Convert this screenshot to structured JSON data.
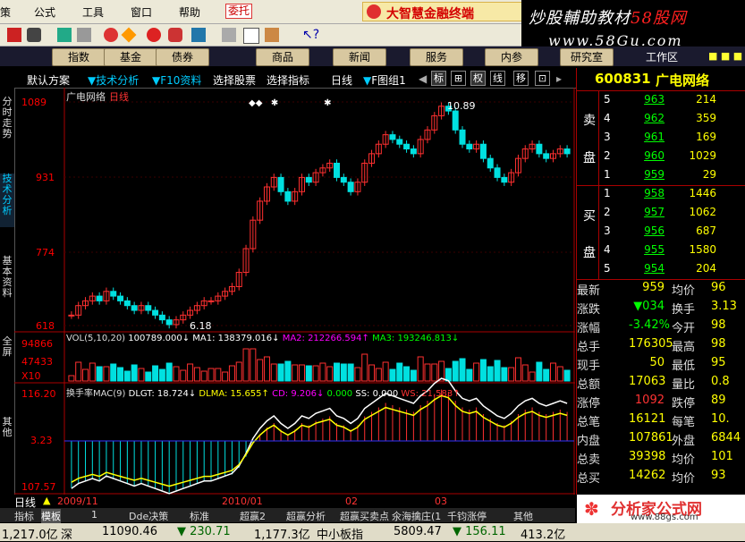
{
  "menu": {
    "items": [
      "策",
      "公式",
      "工具",
      "窗口",
      "帮助"
    ],
    "entrust": "委托"
  },
  "brand": {
    "title": "大智慧金融终端"
  },
  "watermark": {
    "line1_a": "炒股輔助教材",
    "line1_b": "58股网",
    "line2": "www.58Gu.com"
  },
  "nav": {
    "buttons": [
      "指数",
      "基金",
      "债券",
      "商品",
      "新闻",
      "服务",
      "内参",
      "研究室"
    ],
    "workarea": "工作区",
    "close": "■ ■ ■"
  },
  "subbar": {
    "items": [
      "默认方案",
      "技术分析",
      "F10资料",
      "选择股票",
      "选择指标",
      "日线",
      "F图组1"
    ],
    "boxes": [
      "标",
      "⊞",
      "权",
      "线",
      "移",
      "⊡"
    ]
  },
  "sidetabs": [
    "分时走势",
    "技术分析",
    "基本资料",
    "全屏",
    "其他"
  ],
  "chart": {
    "title": "广电网络",
    "period": "日线",
    "price_ticks": [
      "1089",
      "931",
      "774",
      "618"
    ],
    "high_label": "10.89",
    "low_label": "6.18",
    "vol_legend": {
      "name": "VOL(5,10,20)",
      "v": "100789.000↓",
      "ma1": "MA1: 138379.016↓",
      "ma2": "MA2: 212266.594↑",
      "ma3": "MA3: 193246.813↓"
    },
    "vol_ticks": [
      "94866",
      "47433",
      "X10"
    ],
    "macd_legend": {
      "name": "换手率MAC(9)",
      "dlgt": "DLGT: 18.724↓",
      "dlma": "DLMA: 15.655↑",
      "cd": "CD: 9.206↓",
      "zero": "0.000",
      "ss": "SS: 0.000",
      "ws": "WS: 21.583↑"
    },
    "macd_ticks": [
      "116.20",
      "3.23",
      "107.57"
    ],
    "dates": [
      "日线",
      "2009/11",
      "2010/01",
      "02",
      "03"
    ]
  },
  "chart_data": {
    "type": "candlestick",
    "title": "广电网络",
    "period": "日线",
    "ylim": [
      6.18,
      10.89
    ],
    "price_ticks": [
      10.89,
      9.31,
      7.74,
      6.18
    ],
    "high": 10.89,
    "low": 6.18,
    "dates": [
      "2009/11",
      "2010/01",
      "02",
      "03"
    ]
  },
  "quote": {
    "code": "600831",
    "name": "广电网络",
    "sell_label": [
      "卖",
      "盘"
    ],
    "buy_label": [
      "买",
      "盘"
    ],
    "asks": [
      {
        "i": "5",
        "p": "963",
        "v": "214"
      },
      {
        "i": "4",
        "p": "962",
        "v": "359"
      },
      {
        "i": "3",
        "p": "961",
        "v": "169"
      },
      {
        "i": "2",
        "p": "960",
        "v": "1029"
      },
      {
        "i": "1",
        "p": "959",
        "v": "29"
      }
    ],
    "bids": [
      {
        "i": "1",
        "p": "958",
        "v": "1446"
      },
      {
        "i": "2",
        "p": "957",
        "v": "1062"
      },
      {
        "i": "3",
        "p": "956",
        "v": "687"
      },
      {
        "i": "4",
        "p": "955",
        "v": "1580"
      },
      {
        "i": "5",
        "p": "954",
        "v": "204"
      }
    ],
    "stats": [
      {
        "l": "最新",
        "v": "959",
        "l2": "均价",
        "v2": "96"
      },
      {
        "l": "涨跌",
        "v": "▼034",
        "l2": "换手",
        "v2": "3.13"
      },
      {
        "l": "涨幅",
        "v": "-3.42%",
        "l2": "今开",
        "v2": "98"
      },
      {
        "l": "总手",
        "v": "176305",
        "l2": "最高",
        "v2": "98"
      },
      {
        "l": "现手",
        "v": "50",
        "l2": "最低",
        "v2": "95"
      },
      {
        "l": "总额",
        "v": "17063",
        "l2": "量比",
        "v2": "0.8"
      },
      {
        "l": "涨停",
        "v": "1092",
        "l2": "跌停",
        "v2": "89"
      },
      {
        "l": "总笔",
        "v": "16121",
        "l2": "每笔",
        "v2": "10."
      },
      {
        "l": "内盘",
        "v": "107861",
        "l2": "外盘",
        "v2": "6844"
      },
      {
        "l": "总卖",
        "v": "39398",
        "l2": "均价",
        "v2": "101"
      },
      {
        "l": "总买",
        "v": "14262",
        "l2": "均价",
        "v2": "93"
      }
    ]
  },
  "bottom_tabs": [
    "指标",
    "模板",
    "1",
    "Dde决策",
    "标准",
    "超赢2",
    "超赢分析",
    "超赢买卖点",
    "氽海擒庄(1",
    "千钧涨停",
    "其他"
  ],
  "status": {
    "a": "1,217.0亿",
    "b": "深",
    "c": "11090.46",
    "d": "▼ 230.71",
    "e": "1,177.3亿",
    "f": "中小板指",
    "g": "5809.47",
    "h": "▼ 156.11",
    "i": "413.2亿"
  },
  "logo": {
    "text": "分析家公式网",
    "url": "www.88gs.com"
  },
  "colors": {
    "up": "#ff3030",
    "down": "#00e0e0",
    "accent": "#ffff00"
  }
}
